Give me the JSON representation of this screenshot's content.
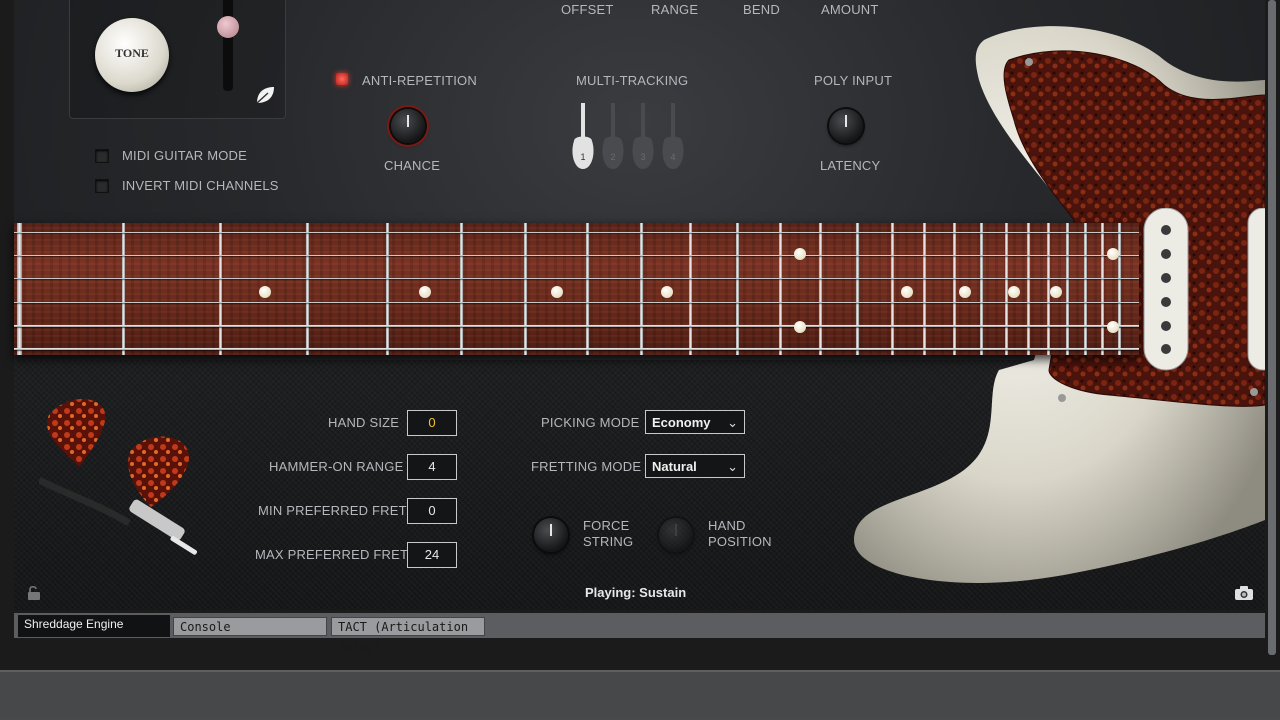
{
  "top_labels": [
    "OFFSET",
    "RANGE",
    "BEND",
    "AMOUNT"
  ],
  "tone_knob": {
    "label": "TONE"
  },
  "checkboxes": [
    {
      "label": "MIDI GUITAR MODE",
      "checked": false
    },
    {
      "label": "INVERT MIDI CHANNELS",
      "checked": false
    }
  ],
  "anti_repetition": {
    "label": "ANTI-REPETITION",
    "knob_label": "CHANCE",
    "led_on": true
  },
  "multi_tracking": {
    "label": "MULTI-TRACKING",
    "tracks": [
      "1",
      "2",
      "3",
      "4"
    ],
    "active_track": "1"
  },
  "poly_input": {
    "label": "POLY INPUT",
    "knob_label": "LATENCY"
  },
  "fields": [
    {
      "label": "HAND SIZE",
      "value": "0",
      "highlight": true
    },
    {
      "label": "HAMMER-ON RANGE",
      "value": "4",
      "highlight": false
    },
    {
      "label": "MIN PREFERRED FRET",
      "value": "0",
      "highlight": false
    },
    {
      "label": "MAX PREFERRED FRET",
      "value": "24",
      "highlight": false
    }
  ],
  "picking_mode": {
    "label": "PICKING MODE",
    "value": "Economy"
  },
  "fretting_mode": {
    "label": "FRETTING MODE",
    "value": "Natural"
  },
  "force_string": {
    "label_line1": "FORCE",
    "label_line2": "STRING"
  },
  "hand_position": {
    "label_line1": "HAND",
    "label_line2": "POSITION"
  },
  "status": {
    "text": "Playing: Sustain"
  },
  "tabs": [
    {
      "label": "Shreddage Engine",
      "active": true
    },
    {
      "label": "Console",
      "active": false
    },
    {
      "label": "TACT (Articulation Setup)",
      "active": false
    }
  ],
  "icons": {
    "leaf": "leaf-icon",
    "lock": "lock-icon",
    "camera": "camera-icon",
    "chevron": "chevron-down-icon"
  },
  "colors": {
    "label": "#b4b7bb",
    "highlight_value": "#f1c232",
    "led_red": "#e03a32",
    "rosewood": "#6a2a1c",
    "guitar_body": "#e8e6dc",
    "tortoise": "#5a1a10"
  }
}
